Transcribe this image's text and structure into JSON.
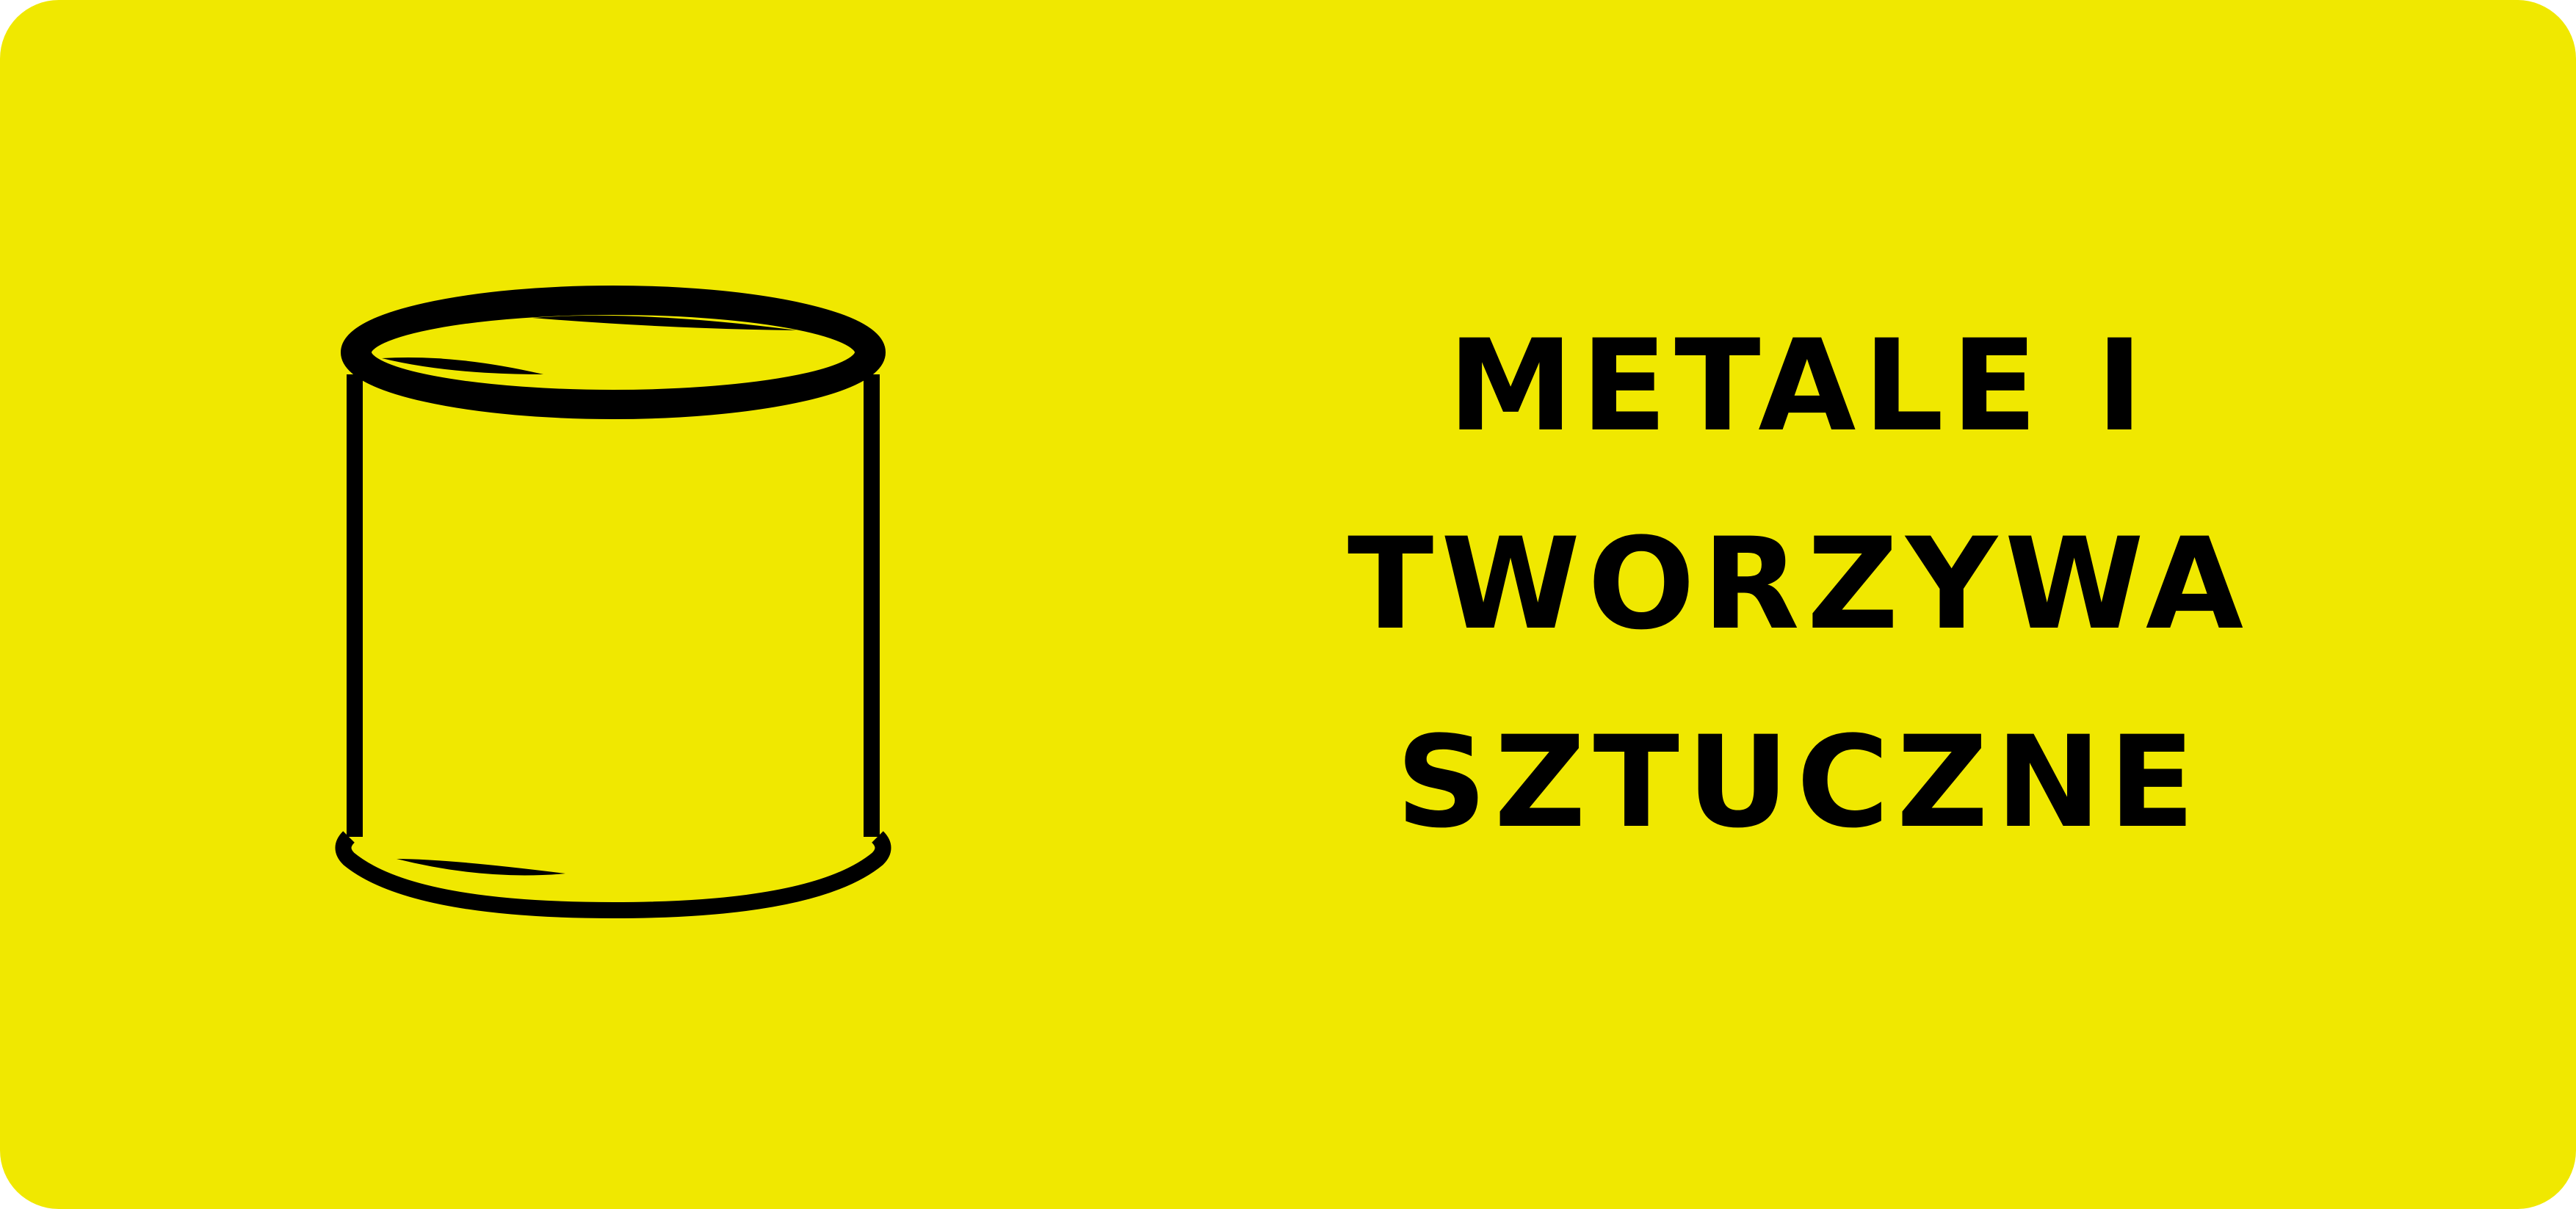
{
  "label": {
    "background_color": "#f0e800",
    "text_color": "#000000",
    "icon": "tin-can-icon",
    "title_lines": [
      "METALE I",
      "TWORZYWA",
      "SZTUCZNE"
    ]
  }
}
